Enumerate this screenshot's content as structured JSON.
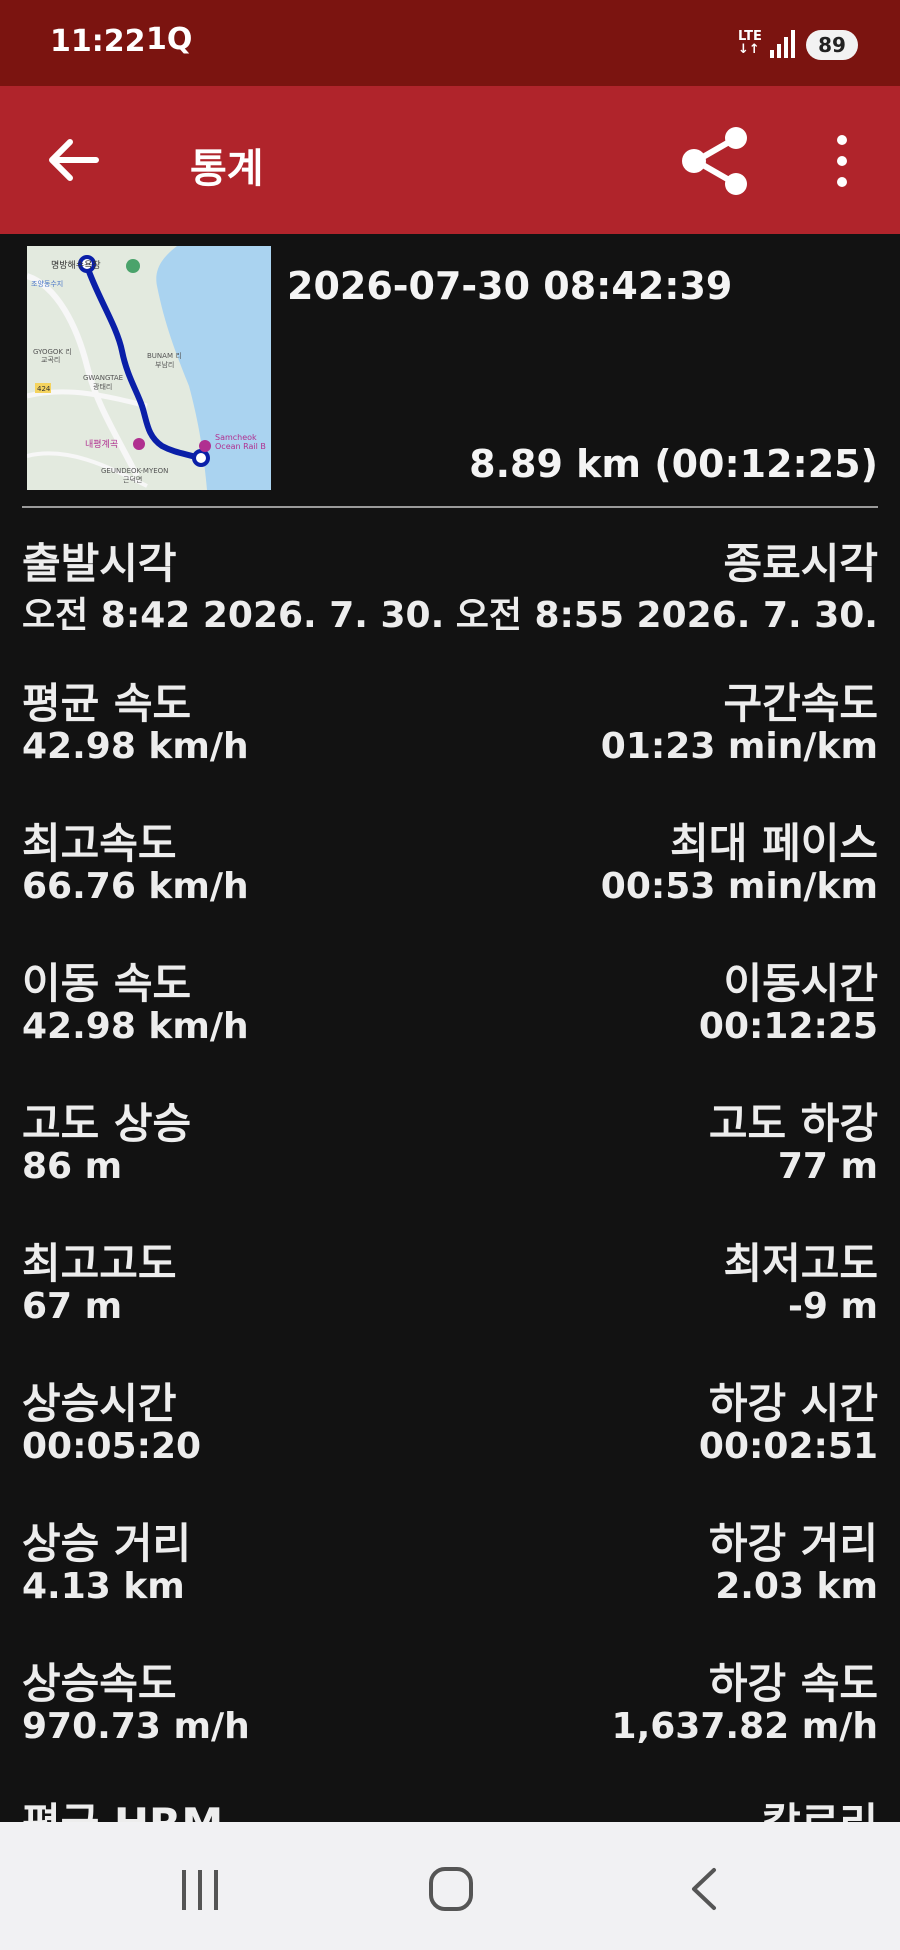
{
  "status": {
    "time": "11:22",
    "carrier_icon_text": "1Q",
    "network": "LTE",
    "battery": "89"
  },
  "appbar": {
    "title": "통계",
    "icons": {
      "back": "back-arrow-icon",
      "share": "share-icon",
      "more": "more-vertical-icon"
    }
  },
  "track": {
    "datetime": "2026-07-30 08:42:39",
    "summary": "8.89 km (00:12:25)",
    "map_labels": {
      "place1": "명방해수욕장",
      "place2": "조양동수지",
      "place3": "GYOGOK 리",
      "place4": "교곡리",
      "place5": "BUNAM 리",
      "place6": "부남리",
      "place7": "GWANGTAE",
      "place8": "광태리",
      "place9": "내평계곡",
      "place10": "GEUNDEOK-MYEON",
      "place11": "근덕면",
      "place12": "Samcheok",
      "place13": "Ocean Rail B",
      "route_no": "424"
    }
  },
  "stats": [
    {
      "left_label": "출발시각",
      "left_value": "오전 8:42 2026. 7. 30.",
      "right_label": "종료시각",
      "right_value": "오전 8:55 2026. 7. 30."
    },
    {
      "left_label": "평균 속도",
      "left_value": "42.98 km/h",
      "right_label": "구간속도",
      "right_value": "01:23 min/km"
    },
    {
      "left_label": "최고속도",
      "left_value": "66.76 km/h",
      "right_label": "최대 페이스",
      "right_value": "00:53 min/km"
    },
    {
      "left_label": "이동 속도",
      "left_value": "42.98 km/h",
      "right_label": "이동시간",
      "right_value": "00:12:25"
    },
    {
      "left_label": "고도 상승",
      "left_value": "86 m",
      "right_label": "고도 하강",
      "right_value": "77 m"
    },
    {
      "left_label": "최고고도",
      "left_value": "67 m",
      "right_label": "최저고도",
      "right_value": "-9 m"
    },
    {
      "left_label": "상승시간",
      "left_value": "00:05:20",
      "right_label": "하강 시간",
      "right_value": "00:02:51"
    },
    {
      "left_label": "상승 거리",
      "left_value": "4.13 km",
      "right_label": "하강 거리",
      "right_value": "2.03 km"
    },
    {
      "left_label": "상승속도",
      "left_value": "970.73 m/h",
      "right_label": "하강 속도",
      "right_value": "1,637.82 m/h"
    },
    {
      "left_label": "평균 HRM",
      "left_value": "",
      "right_label": "칼로리",
      "right_value": ""
    }
  ],
  "navbar": {
    "icons": [
      "recents-icon",
      "home-icon",
      "nav-back-icon"
    ]
  }
}
